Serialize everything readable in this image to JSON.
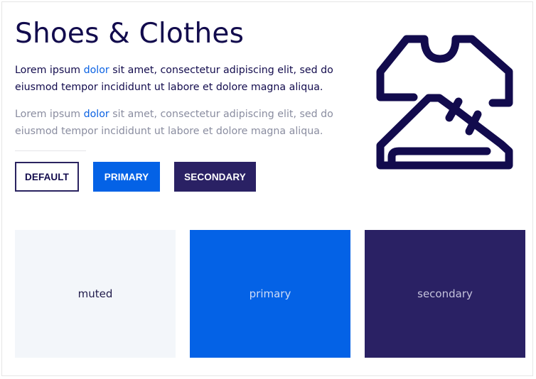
{
  "title": "Shoes & Clothes",
  "paragraph_1": {
    "before": "Lorem ipsum ",
    "link": "dolor",
    "after": " sit amet, consectetur adipiscing elit, sed do eiusmod tempor incididunt ut labore et dolore magna aliqua."
  },
  "paragraph_2": {
    "before": "Lorem ipsum ",
    "link": "dolor",
    "after": " sit amet, consectetur adipiscing elit, sed do eiusmod tempor incididunt ut labore et dolore magna aliqua."
  },
  "buttons": {
    "default_label": "DEFAULT",
    "primary_label": "PRIMARY",
    "secondary_label": "SECONDARY"
  },
  "tiles": {
    "muted_label": "muted",
    "primary_label": "primary",
    "secondary_label": "secondary"
  },
  "illustration_icon": "shirt-and-shoe-icon",
  "colors": {
    "heading": "#120b4d",
    "link": "#0b62e3",
    "muted_text": "#8a8da0",
    "primary": "#0462e6",
    "secondary": "#2a2164",
    "muted_bg": "#f3f6fa"
  }
}
